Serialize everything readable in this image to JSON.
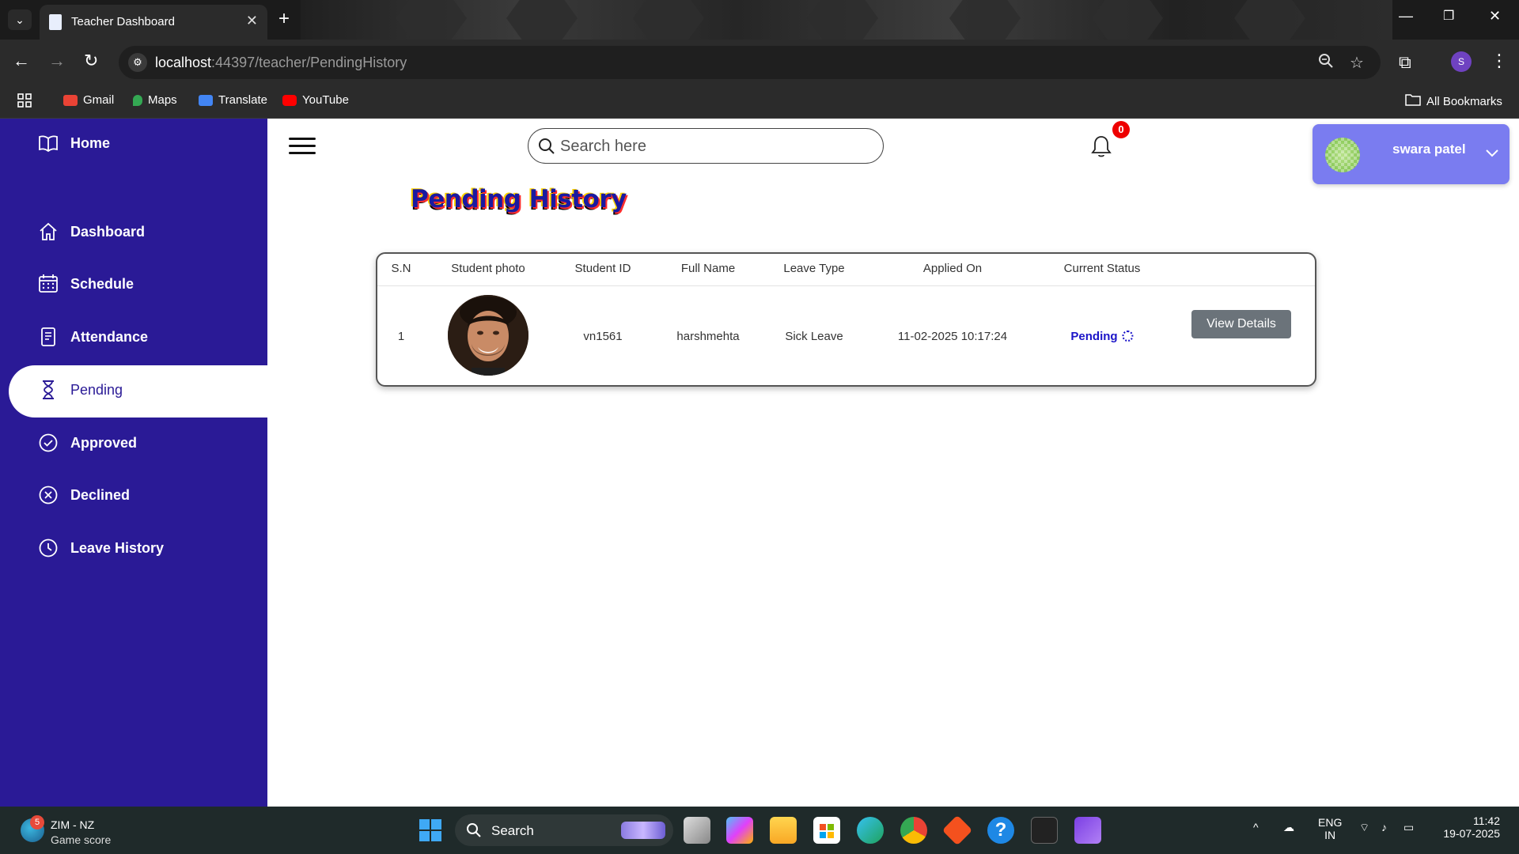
{
  "browser": {
    "tab_title": "Teacher Dashboard",
    "url_host": "localhost",
    "url_rest": ":44397/teacher/PendingHistory",
    "profile_initial": "S",
    "bookmarks": [
      {
        "label": "Gmail",
        "icon": "gmail-icon",
        "color": "#ea4335"
      },
      {
        "label": "Maps",
        "icon": "maps-icon",
        "color": "#34a853"
      },
      {
        "label": "Translate",
        "icon": "translate-icon",
        "color": "#4285f4"
      },
      {
        "label": "YouTube",
        "icon": "youtube-icon",
        "color": "#ff0000"
      }
    ],
    "all_bookmarks": "All Bookmarks"
  },
  "sidebar": {
    "items": [
      {
        "label": "Home",
        "icon": "book-icon"
      },
      {
        "label": "Dashboard",
        "icon": "house-icon"
      },
      {
        "label": "Schedule",
        "icon": "calendar-icon"
      },
      {
        "label": "Attendance",
        "icon": "document-icon"
      },
      {
        "label": "Pending",
        "icon": "hourglass-icon",
        "active": true
      },
      {
        "label": "Approved",
        "icon": "check-circle-icon"
      },
      {
        "label": "Declined",
        "icon": "x-circle-icon"
      },
      {
        "label": "Leave History",
        "icon": "clock-icon"
      }
    ],
    "color": "#2a1a96"
  },
  "header": {
    "search_placeholder": "Search here",
    "notification_count": "0",
    "user_name": "swara patel"
  },
  "page": {
    "title": "Pending History"
  },
  "table": {
    "columns": [
      "S.N",
      "Student photo",
      "Student ID",
      "Full Name",
      "Leave Type",
      "Applied On",
      "Current Status"
    ],
    "rows": [
      {
        "sn": "1",
        "student_id": "vn1561",
        "full_name": "harshmehta",
        "leave_type": "Sick Leave",
        "applied_on": "11-02-2025 10:17:24",
        "status": "Pending",
        "action": "View Details"
      }
    ]
  },
  "taskbar": {
    "widget_badge": "5",
    "widget_line1": "ZIM - NZ",
    "widget_line2": "Game score",
    "search_label": "Search",
    "lang_line1": "ENG",
    "lang_line2": "IN",
    "time": "11:42",
    "date": "19-07-2025"
  }
}
